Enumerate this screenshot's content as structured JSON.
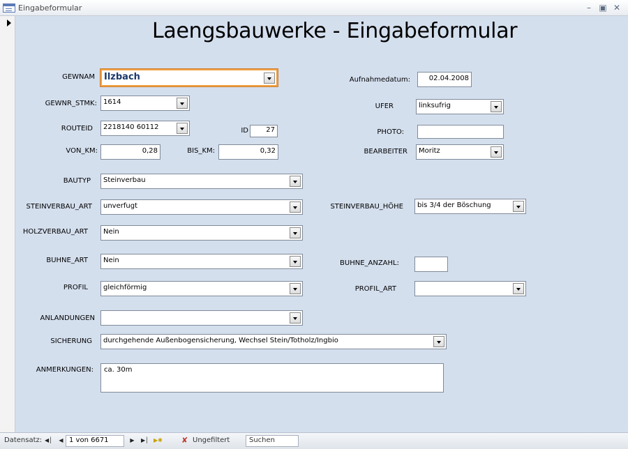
{
  "window": {
    "title": "Eingabeformular"
  },
  "form": {
    "title": "Laengsbauwerke - Eingabeformular",
    "gewnam": {
      "label": "GEWNAM",
      "value": "Ilzbach"
    },
    "gewnr_stmk": {
      "label": "GEWNR_STMK:",
      "value": "1614"
    },
    "routeid": {
      "label": "ROUTEID",
      "value": "2218140 60112"
    },
    "id": {
      "label": "ID",
      "value": "27"
    },
    "von_km": {
      "label": "VON_KM:",
      "value": "0,28"
    },
    "bis_km": {
      "label": "BIS_KM:",
      "value": "0,32"
    },
    "aufnahmedatum": {
      "label": "Aufnahmedatum:",
      "value": "02.04.2008"
    },
    "ufer": {
      "label": "UFER",
      "value": "linksufrig"
    },
    "photo": {
      "label": "PHOTO:",
      "value": ""
    },
    "bearbeiter": {
      "label": "BEARBEITER",
      "value": "Moritz"
    },
    "bautyp": {
      "label": "BAUTYP",
      "value": "Steinverbau"
    },
    "steinverbau_art": {
      "label": "STEINVERBAU_ART",
      "value": "unverfugt"
    },
    "steinverbau_hoehe": {
      "label": "STEINVERBAU_HÖHE",
      "value": "bis 3/4 der Böschung"
    },
    "holzverbau_art": {
      "label": "HOLZVERBAU_ART",
      "value": "Nein"
    },
    "buhne_art": {
      "label": "BUHNE_ART",
      "value": "Nein"
    },
    "buhne_anzahl": {
      "label": "BUHNE_ANZAHL:",
      "value": ""
    },
    "profil": {
      "label": "PROFIL",
      "value": "gleichförmig"
    },
    "profil_art": {
      "label": "PROFIL_ART",
      "value": ""
    },
    "anlandungen": {
      "label": "ANLANDUNGEN",
      "value": ""
    },
    "sicherung": {
      "label": "SICHERUNG",
      "value": "durchgehende Außenbogensicherung, Wechsel Stein/Totholz/Ingbio"
    },
    "anmerkungen": {
      "label": "ANMERKUNGEN:",
      "value": "ca. 30m"
    }
  },
  "statusbar": {
    "record_label": "Datensatz:",
    "record_position": "1 von 6671",
    "filter_label": "Ungefiltert",
    "search_placeholder": "Suchen"
  }
}
